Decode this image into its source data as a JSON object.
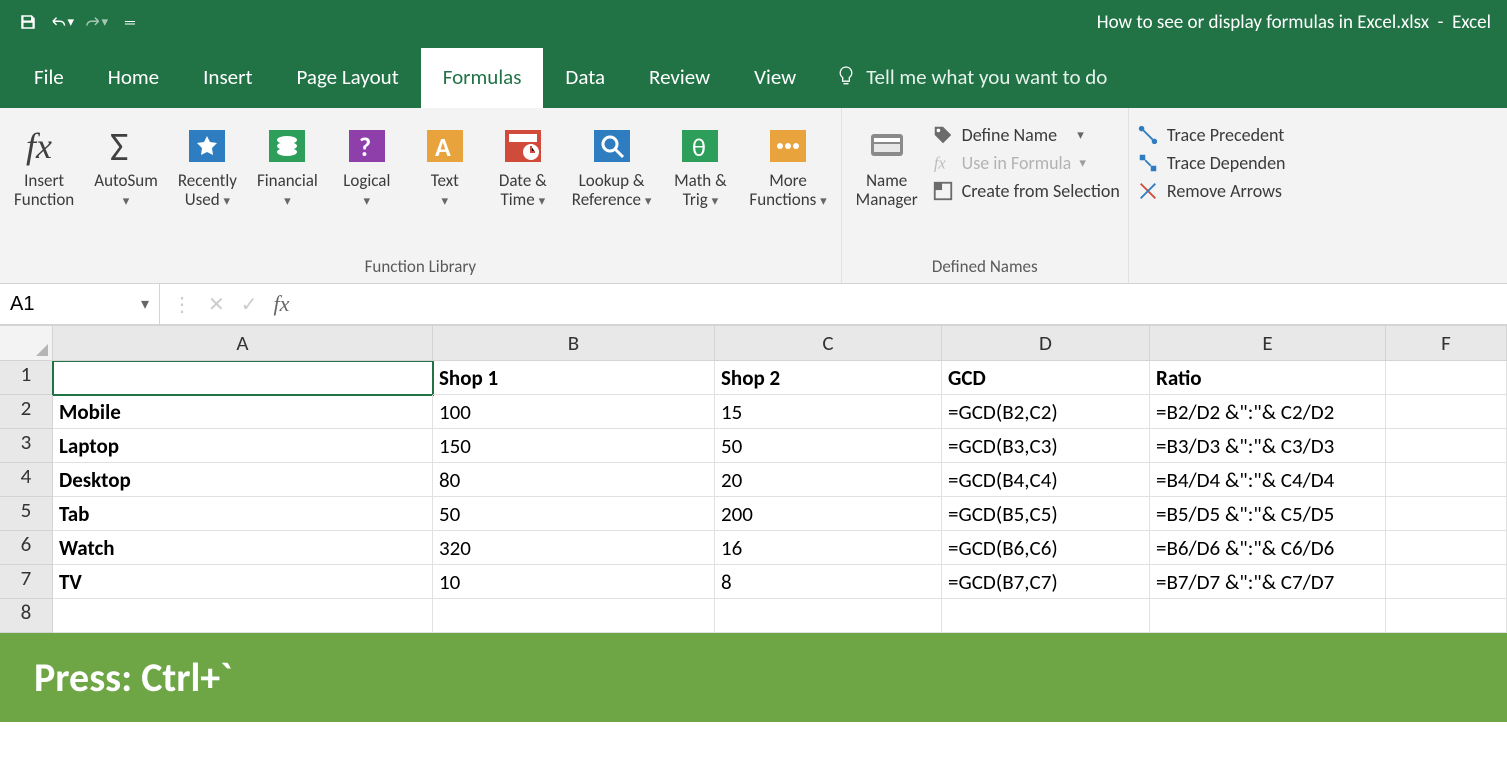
{
  "window": {
    "title_file": "How to see or display formulas in Excel.xlsx",
    "title_app": "Excel"
  },
  "tabs": {
    "file": "File",
    "home": "Home",
    "insert": "Insert",
    "page_layout": "Page Layout",
    "formulas": "Formulas",
    "data": "Data",
    "review": "Review",
    "view": "View",
    "tell_me": "Tell me what you want to do"
  },
  "ribbon": {
    "insert_function": "Insert\nFunction",
    "autosum": "AutoSum",
    "recently_used": "Recently\nUsed",
    "financial": "Financial",
    "logical": "Logical",
    "text": "Text",
    "date_time": "Date &\nTime",
    "lookup_ref": "Lookup &\nReference",
    "math_trig": "Math &\nTrig",
    "more_funcs": "More\nFunctions",
    "function_library": "Function Library",
    "name_manager": "Name\nManager",
    "define_name": "Define Name",
    "use_in_formula": "Use in Formula",
    "create_from_selection": "Create from Selection",
    "defined_names": "Defined Names",
    "trace_precedents": "Trace Precedent",
    "trace_dependents": "Trace Dependen",
    "remove_arrows": "Remove Arrows"
  },
  "formula_bar": {
    "name_box": "A1",
    "fx": "fx",
    "formula": ""
  },
  "grid": {
    "col_headers": [
      "A",
      "B",
      "C",
      "D",
      "E",
      "F"
    ],
    "row_headers": [
      "1",
      "2",
      "3",
      "4",
      "5",
      "6",
      "7",
      "8"
    ],
    "rows": [
      {
        "a": "",
        "b": "Shop 1",
        "c": "Shop 2",
        "d": "GCD",
        "e": "Ratio",
        "bold": true
      },
      {
        "a": "Mobile",
        "b": "100",
        "c": "15",
        "d": "=GCD(B2,C2)",
        "e": "=B2/D2 &\":\"& C2/D2",
        "bold": false
      },
      {
        "a": "Laptop",
        "b": "150",
        "c": "50",
        "d": "=GCD(B3,C3)",
        "e": "=B3/D3 &\":\"& C3/D3",
        "bold": false
      },
      {
        "a": "Desktop",
        "b": "80",
        "c": "20",
        "d": "=GCD(B4,C4)",
        "e": "=B4/D4 &\":\"& C4/D4",
        "bold": false
      },
      {
        "a": "Tab",
        "b": "50",
        "c": "200",
        "d": "=GCD(B5,C5)",
        "e": "=B5/D5 &\":\"& C5/D5",
        "bold": false
      },
      {
        "a": "Watch",
        "b": "320",
        "c": "16",
        "d": "=GCD(B6,C6)",
        "e": "=B6/D6 &\":\"& C6/D6",
        "bold": false
      },
      {
        "a": "TV",
        "b": "10",
        "c": "8",
        "d": "=GCD(B7,C7)",
        "e": "=B7/D7 &\":\"& C7/D7",
        "bold": false
      },
      {
        "a": "",
        "b": "",
        "c": "",
        "d": "",
        "e": "",
        "bold": false
      }
    ]
  },
  "banner": "Press: Ctrl+`"
}
